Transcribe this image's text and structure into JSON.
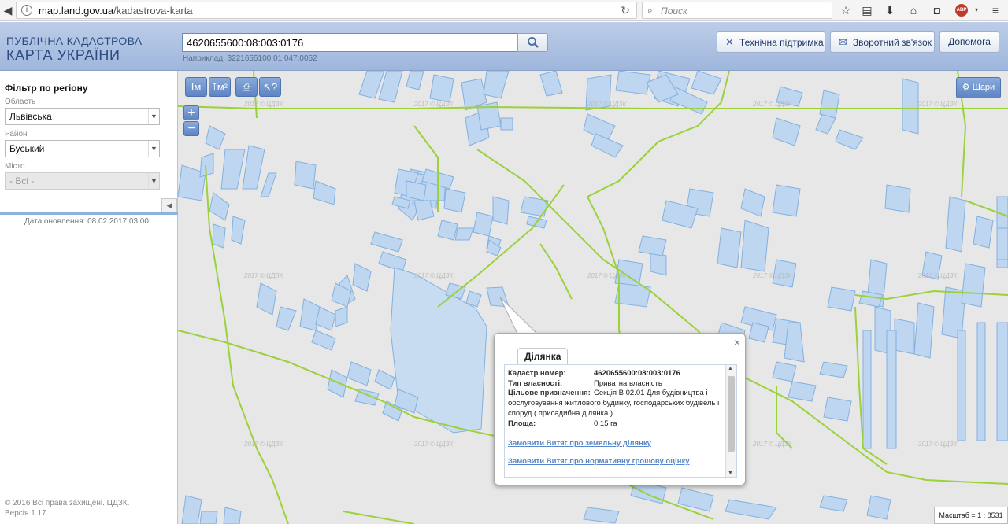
{
  "browser": {
    "url_host": "map.land.gov.ua",
    "url_path": "/kadastrova-karta",
    "search_placeholder": "Поиск",
    "abp_label": "ABP"
  },
  "header": {
    "logo_line1": "ПУБЛІЧНА КАДАСТРОВА",
    "logo_line2": "КАРТА УКРАЇНИ",
    "search_value": "4620655600:08:003:0176",
    "search_example": "Наприклад: 3221655100:01:047:0052",
    "support_label": "Технічна підтримка",
    "feedback_label": "Зворотний зв'язок",
    "help_label": "Допомога"
  },
  "sidebar": {
    "filter_title": "Фільтр по регіону",
    "region_label": "Область",
    "region_value": "Львівська",
    "district_label": "Район",
    "district_value": "Буський",
    "city_label": "Місто",
    "city_value": "- Всі -",
    "update_date": "Дата оновлення: 08.02.2017 03:00",
    "copyright": "© 2016 Всі права захищені. ЦДЗК. Версія 1.17."
  },
  "map": {
    "watermark": "2017 © ЦДЗК",
    "layers_label": "Шари",
    "scale_label": "Масштаб = 1 : 8531",
    "zoom_in": "+",
    "zoom_out": "−",
    "tool_labels": [
      "Iм",
      "⊺м²",
      "⎙",
      "↖?"
    ],
    "parcel_fill": "#bcd6f0",
    "parcel_stroke": "#7eaee0",
    "boundary_color": "#9bd13b"
  },
  "popup": {
    "tab_label": "Ділянка",
    "cadastral_key": "Кадастр.номер:",
    "cadastral_value": "4620655600:08:003:0176",
    "ownership_key": "Тип власності:",
    "ownership_value": "Приватна власність",
    "purpose_key": "Цільове призначення:",
    "purpose_value_line1": "Секція В 02.01 Для будівництва і",
    "purpose_value_line2": "обслуговування житлового будинку, господарських будівель і",
    "purpose_value_line3": "споруд ( присадибна ділянка )",
    "area_key": "Площа:",
    "area_value": "0.15 га",
    "link_extract": "Замовити Витяг про земельну ділянку",
    "link_valuation": "Замовити Витяг про нормативну грошову оцінку",
    "close_label": "×"
  }
}
